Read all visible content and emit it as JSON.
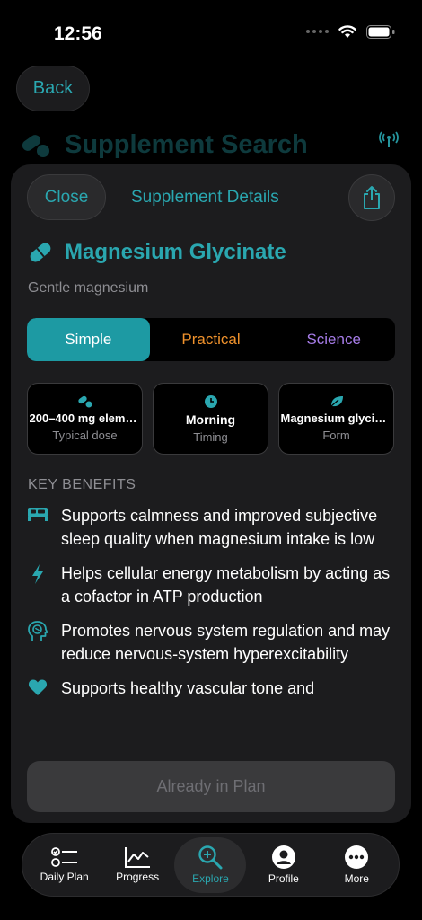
{
  "status": {
    "time": "12:56"
  },
  "nav": {
    "back_label": "Back",
    "bg_title": "Supplement Search"
  },
  "sheet": {
    "close_label": "Close",
    "title": "Supplement Details",
    "supplement_name": "Magnesium Glycinate",
    "subtitle": "Gentle magnesium",
    "segments": [
      "Simple",
      "Practical",
      "Science"
    ],
    "selected_segment": "Simple",
    "cards": [
      {
        "value": "200–400 mg eleme...",
        "label": "Typical dose",
        "icon": "pills-icon"
      },
      {
        "value": "Morning",
        "label": "Timing",
        "icon": "clock-icon"
      },
      {
        "value": "Magnesium glycina...",
        "label": "Form",
        "icon": "leaf-icon"
      }
    ],
    "key_benefits_header": "KEY BENEFITS",
    "benefits": [
      {
        "icon": "bed-icon",
        "text": "Supports calmness and improved subjective sleep quality when magnesium intake is low"
      },
      {
        "icon": "bolt-icon",
        "text": "Helps cellular energy metabolism by acting as a cofactor in ATP production"
      },
      {
        "icon": "brain-head-icon",
        "text": "Promotes nervous system regulation and may reduce nervous-system hyperexcitability"
      },
      {
        "icon": "heart-icon",
        "text": "Supports healthy vascular tone and"
      }
    ],
    "plan_button_label": "Already in Plan"
  },
  "tabs": [
    {
      "label": "Daily Plan",
      "icon": "checklist-icon"
    },
    {
      "label": "Progress",
      "icon": "chart-icon"
    },
    {
      "label": "Explore",
      "icon": "search-icon",
      "active": true
    },
    {
      "label": "Profile",
      "icon": "person-icon"
    },
    {
      "label": "More",
      "icon": "ellipsis-icon"
    }
  ],
  "colors": {
    "accent": "#2aa7b0",
    "practical": "#f0922c",
    "science": "#a67ce8",
    "background": "#000000",
    "sheet": "#1c1c1e"
  }
}
